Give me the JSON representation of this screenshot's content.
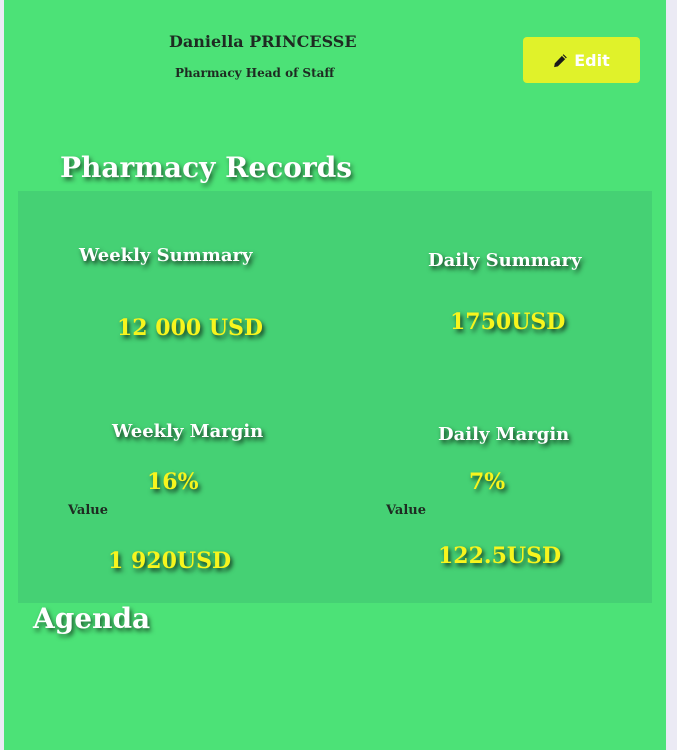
{
  "profile": {
    "name": "Daniella PRINCESSE",
    "role": "Pharmacy Head of Staff"
  },
  "toolbar": {
    "edit_label": "Edit",
    "edit_icon": "pencil-icon"
  },
  "records": {
    "title": "Pharmacy Records",
    "weekly_summary": {
      "label": "Weekly Summary",
      "value": "12 000 USD"
    },
    "daily_summary": {
      "label": "Daily Summary",
      "value": "1750USD"
    },
    "weekly_margin": {
      "label": "Weekly Margin",
      "percent": "16%",
      "value_caption": "Value",
      "value": "1 920USD"
    },
    "daily_margin": {
      "label": "Daily Margin",
      "percent": "7%",
      "value_caption": "Value",
      "value": "122.5USD"
    }
  },
  "agenda": {
    "title": "Agenda"
  },
  "colors": {
    "background": "#4ce277",
    "panel": "#45d174",
    "button": "#e0f22a",
    "value_text": "#f7f51e"
  }
}
